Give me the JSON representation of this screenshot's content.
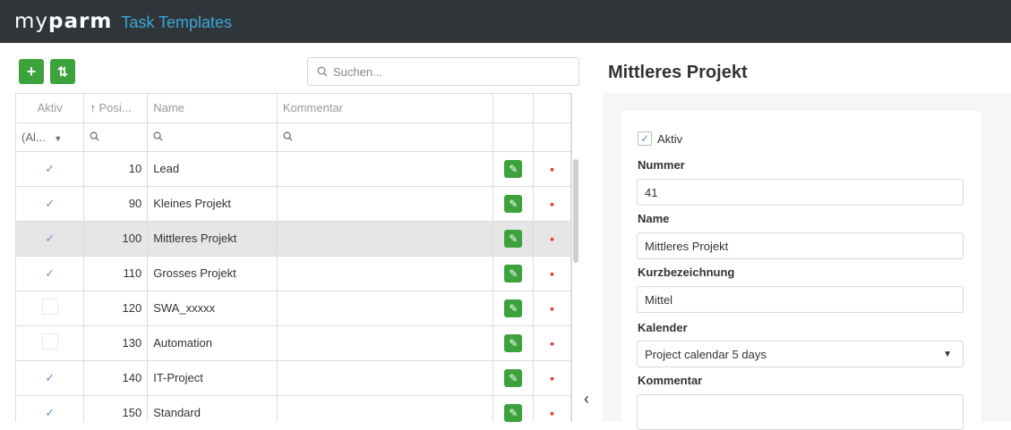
{
  "header": {
    "logo_light": "my",
    "logo_bold": "parm",
    "title": "Task Templates"
  },
  "toolbar": {
    "add_icon": "+",
    "sort_icon": "⇅"
  },
  "search": {
    "placeholder": "Suchen..."
  },
  "grid": {
    "columns": {
      "aktiv": "Aktiv",
      "position": "Posi...",
      "name": "Name",
      "kommentar": "Kommentar"
    },
    "filter": {
      "aktiv": "(Al..."
    },
    "rows": [
      {
        "aktiv": true,
        "position": "10",
        "name": "Lead",
        "kommentar": ""
      },
      {
        "aktiv": true,
        "position": "90",
        "name": "Kleines Projekt",
        "kommentar": ""
      },
      {
        "aktiv": true,
        "position": "100",
        "name": "Mittleres Projekt",
        "kommentar": "",
        "selected": true
      },
      {
        "aktiv": true,
        "position": "110",
        "name": "Grosses Projekt",
        "kommentar": ""
      },
      {
        "aktiv": false,
        "position": "120",
        "name": "SWA_xxxxx",
        "kommentar": ""
      },
      {
        "aktiv": false,
        "position": "130",
        "name": "Automation",
        "kommentar": ""
      },
      {
        "aktiv": true,
        "position": "140",
        "name": "IT-Project",
        "kommentar": ""
      },
      {
        "aktiv": true,
        "position": "150",
        "name": "Standard",
        "kommentar": ""
      }
    ]
  },
  "detail": {
    "title": "Mittleres Projekt",
    "aktiv_label": "Aktiv",
    "nummer_label": "Nummer",
    "nummer_value": "41",
    "name_label": "Name",
    "name_value": "Mittleres Projekt",
    "kurz_label": "Kurzbezeichnung",
    "kurz_value": "Mittel",
    "kalender_label": "Kalender",
    "kalender_value": "Project calendar 5 days",
    "kommentar_label": "Kommentar",
    "kommentar_value": ""
  },
  "colors": {
    "header_bg": "#2f3539",
    "accent_blue": "#3aa7d9",
    "button_green": "#3ca23c",
    "delete_red": "#e0403a"
  }
}
